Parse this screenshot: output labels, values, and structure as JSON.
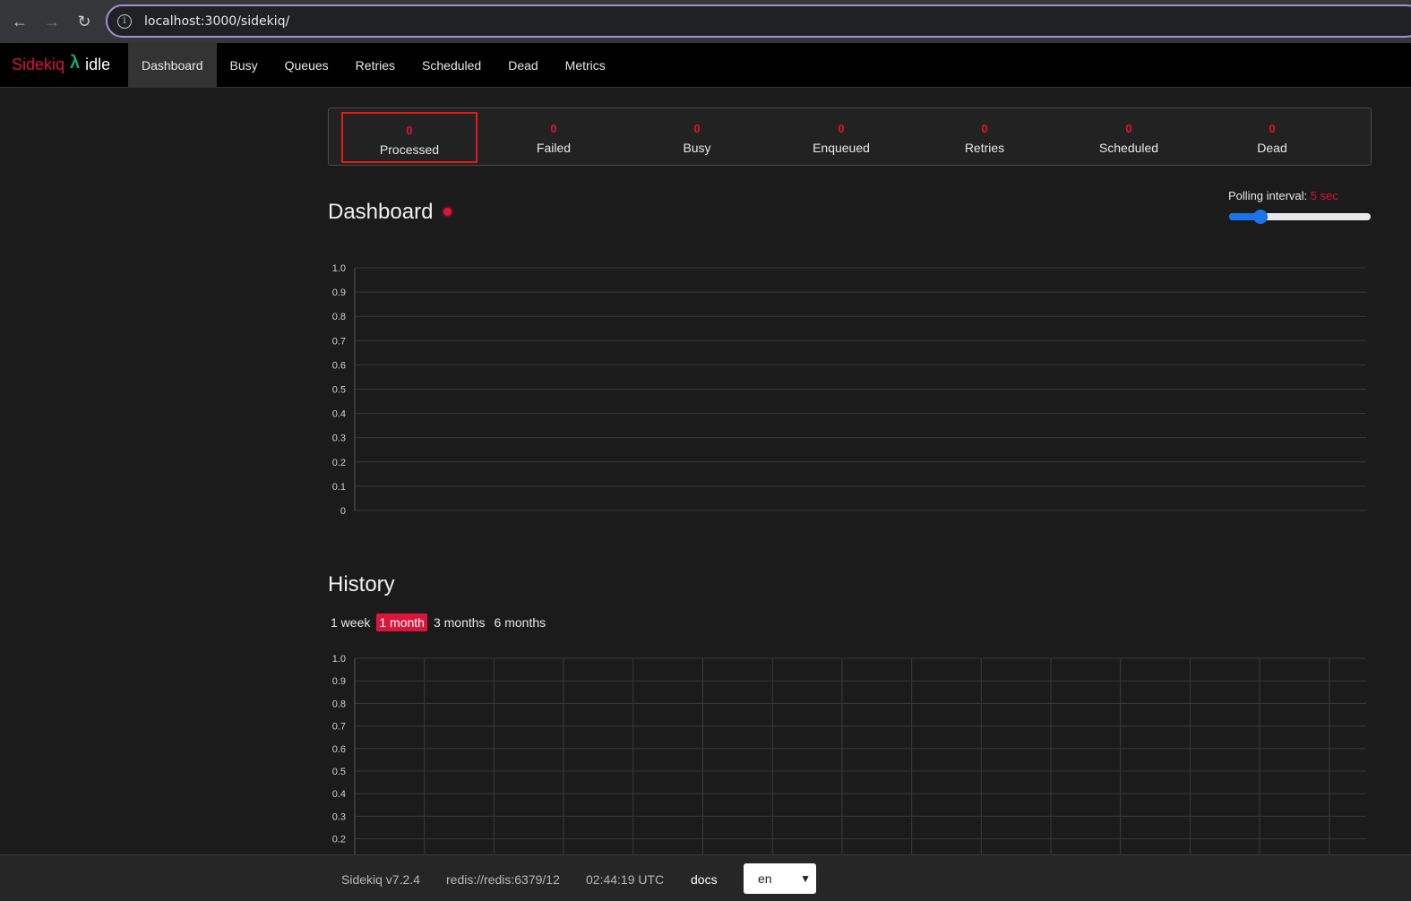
{
  "browser": {
    "url": "localhost:3000/sidekiq/"
  },
  "brand": {
    "name": "Sidekiq",
    "status": "idle"
  },
  "nav": {
    "items": [
      {
        "label": "Dashboard",
        "active": true
      },
      {
        "label": "Busy"
      },
      {
        "label": "Queues"
      },
      {
        "label": "Retries"
      },
      {
        "label": "Scheduled"
      },
      {
        "label": "Dead"
      },
      {
        "label": "Metrics"
      }
    ]
  },
  "stats": [
    {
      "value": "0",
      "label": "Processed"
    },
    {
      "value": "0",
      "label": "Failed"
    },
    {
      "value": "0",
      "label": "Busy"
    },
    {
      "value": "0",
      "label": "Enqueued"
    },
    {
      "value": "0",
      "label": "Retries"
    },
    {
      "value": "0",
      "label": "Scheduled"
    },
    {
      "value": "0",
      "label": "Dead"
    }
  ],
  "dashboard": {
    "title": "Dashboard",
    "polling_label": "Polling interval:",
    "polling_value": "5 sec",
    "polling_fraction": 0.22
  },
  "history": {
    "title": "History",
    "ranges": [
      {
        "label": "1 week"
      },
      {
        "label": "1 month",
        "active": true
      },
      {
        "label": "3 months"
      },
      {
        "label": "6 months"
      }
    ]
  },
  "footer": {
    "version": "Sidekiq v7.2.4",
    "redis": "redis://redis:6379/12",
    "time": "02:44:19 UTC",
    "docs": "docs",
    "locale": "en"
  },
  "chart_data": [
    {
      "type": "line",
      "title": "",
      "ylim": [
        0,
        1.0
      ],
      "yticks": [
        "1.0",
        "0.9",
        "0.8",
        "0.7",
        "0.6",
        "0.5",
        "0.4",
        "0.3",
        "0.2",
        "0.1",
        "0"
      ],
      "series": [],
      "grid": true
    },
    {
      "type": "line",
      "title": "",
      "ylim": [
        0,
        1.0
      ],
      "yticks": [
        "1.0",
        "0.9",
        "0.8",
        "0.7",
        "0.6",
        "0.5",
        "0.4",
        "0.3",
        "0.2"
      ],
      "series": [],
      "grid": true
    }
  ]
}
